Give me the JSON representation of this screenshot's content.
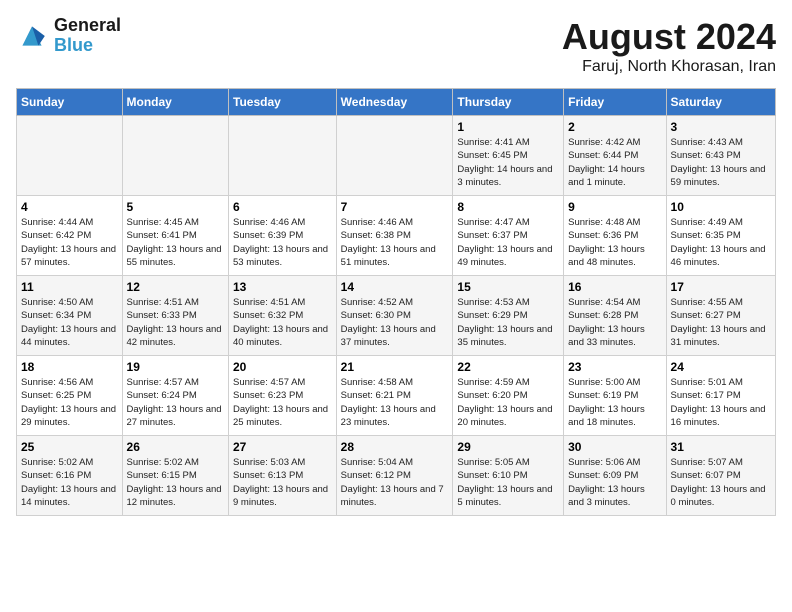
{
  "logo": {
    "text_general": "General",
    "text_blue": "Blue"
  },
  "title": "August 2024",
  "subtitle": "Faruj, North Khorasan, Iran",
  "days_of_week": [
    "Sunday",
    "Monday",
    "Tuesday",
    "Wednesday",
    "Thursday",
    "Friday",
    "Saturday"
  ],
  "weeks": [
    [
      {
        "day": "",
        "sunrise": "",
        "sunset": "",
        "daylight": ""
      },
      {
        "day": "",
        "sunrise": "",
        "sunset": "",
        "daylight": ""
      },
      {
        "day": "",
        "sunrise": "",
        "sunset": "",
        "daylight": ""
      },
      {
        "day": "",
        "sunrise": "",
        "sunset": "",
        "daylight": ""
      },
      {
        "day": "1",
        "sunrise": "Sunrise: 4:41 AM",
        "sunset": "Sunset: 6:45 PM",
        "daylight": "Daylight: 14 hours and 3 minutes."
      },
      {
        "day": "2",
        "sunrise": "Sunrise: 4:42 AM",
        "sunset": "Sunset: 6:44 PM",
        "daylight": "Daylight: 14 hours and 1 minute."
      },
      {
        "day": "3",
        "sunrise": "Sunrise: 4:43 AM",
        "sunset": "Sunset: 6:43 PM",
        "daylight": "Daylight: 13 hours and 59 minutes."
      }
    ],
    [
      {
        "day": "4",
        "sunrise": "Sunrise: 4:44 AM",
        "sunset": "Sunset: 6:42 PM",
        "daylight": "Daylight: 13 hours and 57 minutes."
      },
      {
        "day": "5",
        "sunrise": "Sunrise: 4:45 AM",
        "sunset": "Sunset: 6:41 PM",
        "daylight": "Daylight: 13 hours and 55 minutes."
      },
      {
        "day": "6",
        "sunrise": "Sunrise: 4:46 AM",
        "sunset": "Sunset: 6:39 PM",
        "daylight": "Daylight: 13 hours and 53 minutes."
      },
      {
        "day": "7",
        "sunrise": "Sunrise: 4:46 AM",
        "sunset": "Sunset: 6:38 PM",
        "daylight": "Daylight: 13 hours and 51 minutes."
      },
      {
        "day": "8",
        "sunrise": "Sunrise: 4:47 AM",
        "sunset": "Sunset: 6:37 PM",
        "daylight": "Daylight: 13 hours and 49 minutes."
      },
      {
        "day": "9",
        "sunrise": "Sunrise: 4:48 AM",
        "sunset": "Sunset: 6:36 PM",
        "daylight": "Daylight: 13 hours and 48 minutes."
      },
      {
        "day": "10",
        "sunrise": "Sunrise: 4:49 AM",
        "sunset": "Sunset: 6:35 PM",
        "daylight": "Daylight: 13 hours and 46 minutes."
      }
    ],
    [
      {
        "day": "11",
        "sunrise": "Sunrise: 4:50 AM",
        "sunset": "Sunset: 6:34 PM",
        "daylight": "Daylight: 13 hours and 44 minutes."
      },
      {
        "day": "12",
        "sunrise": "Sunrise: 4:51 AM",
        "sunset": "Sunset: 6:33 PM",
        "daylight": "Daylight: 13 hours and 42 minutes."
      },
      {
        "day": "13",
        "sunrise": "Sunrise: 4:51 AM",
        "sunset": "Sunset: 6:32 PM",
        "daylight": "Daylight: 13 hours and 40 minutes."
      },
      {
        "day": "14",
        "sunrise": "Sunrise: 4:52 AM",
        "sunset": "Sunset: 6:30 PM",
        "daylight": "Daylight: 13 hours and 37 minutes."
      },
      {
        "day": "15",
        "sunrise": "Sunrise: 4:53 AM",
        "sunset": "Sunset: 6:29 PM",
        "daylight": "Daylight: 13 hours and 35 minutes."
      },
      {
        "day": "16",
        "sunrise": "Sunrise: 4:54 AM",
        "sunset": "Sunset: 6:28 PM",
        "daylight": "Daylight: 13 hours and 33 minutes."
      },
      {
        "day": "17",
        "sunrise": "Sunrise: 4:55 AM",
        "sunset": "Sunset: 6:27 PM",
        "daylight": "Daylight: 13 hours and 31 minutes."
      }
    ],
    [
      {
        "day": "18",
        "sunrise": "Sunrise: 4:56 AM",
        "sunset": "Sunset: 6:25 PM",
        "daylight": "Daylight: 13 hours and 29 minutes."
      },
      {
        "day": "19",
        "sunrise": "Sunrise: 4:57 AM",
        "sunset": "Sunset: 6:24 PM",
        "daylight": "Daylight: 13 hours and 27 minutes."
      },
      {
        "day": "20",
        "sunrise": "Sunrise: 4:57 AM",
        "sunset": "Sunset: 6:23 PM",
        "daylight": "Daylight: 13 hours and 25 minutes."
      },
      {
        "day": "21",
        "sunrise": "Sunrise: 4:58 AM",
        "sunset": "Sunset: 6:21 PM",
        "daylight": "Daylight: 13 hours and 23 minutes."
      },
      {
        "day": "22",
        "sunrise": "Sunrise: 4:59 AM",
        "sunset": "Sunset: 6:20 PM",
        "daylight": "Daylight: 13 hours and 20 minutes."
      },
      {
        "day": "23",
        "sunrise": "Sunrise: 5:00 AM",
        "sunset": "Sunset: 6:19 PM",
        "daylight": "Daylight: 13 hours and 18 minutes."
      },
      {
        "day": "24",
        "sunrise": "Sunrise: 5:01 AM",
        "sunset": "Sunset: 6:17 PM",
        "daylight": "Daylight: 13 hours and 16 minutes."
      }
    ],
    [
      {
        "day": "25",
        "sunrise": "Sunrise: 5:02 AM",
        "sunset": "Sunset: 6:16 PM",
        "daylight": "Daylight: 13 hours and 14 minutes."
      },
      {
        "day": "26",
        "sunrise": "Sunrise: 5:02 AM",
        "sunset": "Sunset: 6:15 PM",
        "daylight": "Daylight: 13 hours and 12 minutes."
      },
      {
        "day": "27",
        "sunrise": "Sunrise: 5:03 AM",
        "sunset": "Sunset: 6:13 PM",
        "daylight": "Daylight: 13 hours and 9 minutes."
      },
      {
        "day": "28",
        "sunrise": "Sunrise: 5:04 AM",
        "sunset": "Sunset: 6:12 PM",
        "daylight": "Daylight: 13 hours and 7 minutes."
      },
      {
        "day": "29",
        "sunrise": "Sunrise: 5:05 AM",
        "sunset": "Sunset: 6:10 PM",
        "daylight": "Daylight: 13 hours and 5 minutes."
      },
      {
        "day": "30",
        "sunrise": "Sunrise: 5:06 AM",
        "sunset": "Sunset: 6:09 PM",
        "daylight": "Daylight: 13 hours and 3 minutes."
      },
      {
        "day": "31",
        "sunrise": "Sunrise: 5:07 AM",
        "sunset": "Sunset: 6:07 PM",
        "daylight": "Daylight: 13 hours and 0 minutes."
      }
    ]
  ]
}
